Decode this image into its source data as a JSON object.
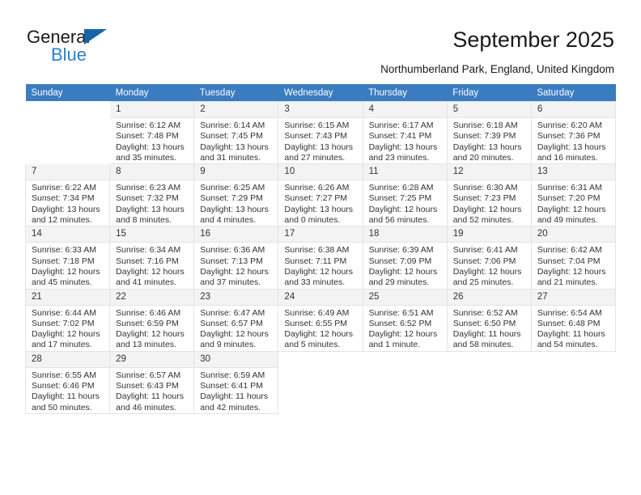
{
  "brand": {
    "name_top": "General",
    "name_bottom": "Blue",
    "triangle_color": "#1565a8",
    "blue_color": "#2a7fd4"
  },
  "header": {
    "title": "September 2025",
    "subtitle": "Northumberland Park, England, United Kingdom",
    "header_bg": "#3b7cc0",
    "header_text_color": "#ffffff"
  },
  "calendar": {
    "weekday_headers": [
      "Sunday",
      "Monday",
      "Tuesday",
      "Wednesday",
      "Thursday",
      "Friday",
      "Saturday"
    ],
    "weeks": [
      [
        {
          "day": "",
          "lines": []
        },
        {
          "day": "1",
          "lines": [
            "Sunrise: 6:12 AM",
            "Sunset: 7:48 PM",
            "Daylight: 13 hours",
            "and 35 minutes."
          ]
        },
        {
          "day": "2",
          "lines": [
            "Sunrise: 6:14 AM",
            "Sunset: 7:45 PM",
            "Daylight: 13 hours",
            "and 31 minutes."
          ]
        },
        {
          "day": "3",
          "lines": [
            "Sunrise: 6:15 AM",
            "Sunset: 7:43 PM",
            "Daylight: 13 hours",
            "and 27 minutes."
          ]
        },
        {
          "day": "4",
          "lines": [
            "Sunrise: 6:17 AM",
            "Sunset: 7:41 PM",
            "Daylight: 13 hours",
            "and 23 minutes."
          ]
        },
        {
          "day": "5",
          "lines": [
            "Sunrise: 6:18 AM",
            "Sunset: 7:39 PM",
            "Daylight: 13 hours",
            "and 20 minutes."
          ]
        },
        {
          "day": "6",
          "lines": [
            "Sunrise: 6:20 AM",
            "Sunset: 7:36 PM",
            "Daylight: 13 hours",
            "and 16 minutes."
          ]
        }
      ],
      [
        {
          "day": "7",
          "lines": [
            "Sunrise: 6:22 AM",
            "Sunset: 7:34 PM",
            "Daylight: 13 hours",
            "and 12 minutes."
          ]
        },
        {
          "day": "8",
          "lines": [
            "Sunrise: 6:23 AM",
            "Sunset: 7:32 PM",
            "Daylight: 13 hours",
            "and 8 minutes."
          ]
        },
        {
          "day": "9",
          "lines": [
            "Sunrise: 6:25 AM",
            "Sunset: 7:29 PM",
            "Daylight: 13 hours",
            "and 4 minutes."
          ]
        },
        {
          "day": "10",
          "lines": [
            "Sunrise: 6:26 AM",
            "Sunset: 7:27 PM",
            "Daylight: 13 hours",
            "and 0 minutes."
          ]
        },
        {
          "day": "11",
          "lines": [
            "Sunrise: 6:28 AM",
            "Sunset: 7:25 PM",
            "Daylight: 12 hours",
            "and 56 minutes."
          ]
        },
        {
          "day": "12",
          "lines": [
            "Sunrise: 6:30 AM",
            "Sunset: 7:23 PM",
            "Daylight: 12 hours",
            "and 52 minutes."
          ]
        },
        {
          "day": "13",
          "lines": [
            "Sunrise: 6:31 AM",
            "Sunset: 7:20 PM",
            "Daylight: 12 hours",
            "and 49 minutes."
          ]
        }
      ],
      [
        {
          "day": "14",
          "lines": [
            "Sunrise: 6:33 AM",
            "Sunset: 7:18 PM",
            "Daylight: 12 hours",
            "and 45 minutes."
          ]
        },
        {
          "day": "15",
          "lines": [
            "Sunrise: 6:34 AM",
            "Sunset: 7:16 PM",
            "Daylight: 12 hours",
            "and 41 minutes."
          ]
        },
        {
          "day": "16",
          "lines": [
            "Sunrise: 6:36 AM",
            "Sunset: 7:13 PM",
            "Daylight: 12 hours",
            "and 37 minutes."
          ]
        },
        {
          "day": "17",
          "lines": [
            "Sunrise: 6:38 AM",
            "Sunset: 7:11 PM",
            "Daylight: 12 hours",
            "and 33 minutes."
          ]
        },
        {
          "day": "18",
          "lines": [
            "Sunrise: 6:39 AM",
            "Sunset: 7:09 PM",
            "Daylight: 12 hours",
            "and 29 minutes."
          ]
        },
        {
          "day": "19",
          "lines": [
            "Sunrise: 6:41 AM",
            "Sunset: 7:06 PM",
            "Daylight: 12 hours",
            "and 25 minutes."
          ]
        },
        {
          "day": "20",
          "lines": [
            "Sunrise: 6:42 AM",
            "Sunset: 7:04 PM",
            "Daylight: 12 hours",
            "and 21 minutes."
          ]
        }
      ],
      [
        {
          "day": "21",
          "lines": [
            "Sunrise: 6:44 AM",
            "Sunset: 7:02 PM",
            "Daylight: 12 hours",
            "and 17 minutes."
          ]
        },
        {
          "day": "22",
          "lines": [
            "Sunrise: 6:46 AM",
            "Sunset: 6:59 PM",
            "Daylight: 12 hours",
            "and 13 minutes."
          ]
        },
        {
          "day": "23",
          "lines": [
            "Sunrise: 6:47 AM",
            "Sunset: 6:57 PM",
            "Daylight: 12 hours",
            "and 9 minutes."
          ]
        },
        {
          "day": "24",
          "lines": [
            "Sunrise: 6:49 AM",
            "Sunset: 6:55 PM",
            "Daylight: 12 hours",
            "and 5 minutes."
          ]
        },
        {
          "day": "25",
          "lines": [
            "Sunrise: 6:51 AM",
            "Sunset: 6:52 PM",
            "Daylight: 12 hours",
            "and 1 minute."
          ]
        },
        {
          "day": "26",
          "lines": [
            "Sunrise: 6:52 AM",
            "Sunset: 6:50 PM",
            "Daylight: 11 hours",
            "and 58 minutes."
          ]
        },
        {
          "day": "27",
          "lines": [
            "Sunrise: 6:54 AM",
            "Sunset: 6:48 PM",
            "Daylight: 11 hours",
            "and 54 minutes."
          ]
        }
      ],
      [
        {
          "day": "28",
          "lines": [
            "Sunrise: 6:55 AM",
            "Sunset: 6:46 PM",
            "Daylight: 11 hours",
            "and 50 minutes."
          ]
        },
        {
          "day": "29",
          "lines": [
            "Sunrise: 6:57 AM",
            "Sunset: 6:43 PM",
            "Daylight: 11 hours",
            "and 46 minutes."
          ]
        },
        {
          "day": "30",
          "lines": [
            "Sunrise: 6:59 AM",
            "Sunset: 6:41 PM",
            "Daylight: 11 hours",
            "and 42 minutes."
          ]
        },
        {
          "day": "",
          "lines": []
        },
        {
          "day": "",
          "lines": []
        },
        {
          "day": "",
          "lines": []
        },
        {
          "day": "",
          "lines": []
        }
      ]
    ]
  }
}
